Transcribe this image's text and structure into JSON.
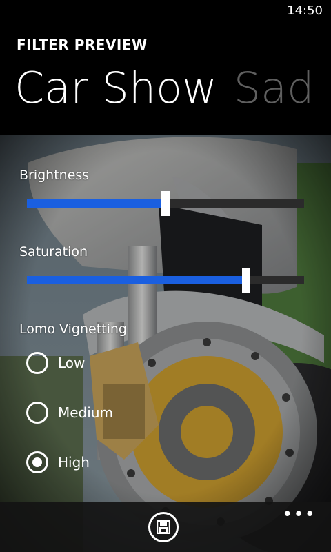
{
  "status_bar": {
    "time": "14:50"
  },
  "app": {
    "title": "FILTER PREVIEW"
  },
  "pivot": {
    "items": [
      {
        "label": "Car Show",
        "active": true
      },
      {
        "label": "Sad",
        "active": false
      }
    ]
  },
  "controls": {
    "brightness": {
      "label": "Brightness",
      "value": 0.5
    },
    "saturation": {
      "label": "Saturation",
      "value": 0.79
    },
    "vignetting": {
      "label": "Lomo Vignetting",
      "options": [
        "Low",
        "Medium",
        "High"
      ],
      "selected": "High"
    }
  },
  "app_bar": {
    "save_icon": "save-icon",
    "more_label": "•••"
  },
  "colors": {
    "accent": "#1a5fe0",
    "track": "#2b2b2b",
    "inactive_pivot": "#5f5f5f"
  }
}
